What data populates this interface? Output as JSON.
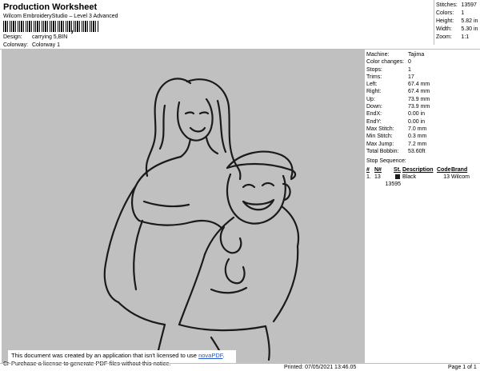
{
  "header": {
    "title": "Production Worksheet",
    "subtitle": "Wilcom EmbroideryStudio – Level 3 Advanced",
    "barcode_comma": ",",
    "design_label": "Design:",
    "design_value": "carrying 5,BIN",
    "colorway_label": "Colorway:",
    "colorway_value": "Colorway 1"
  },
  "summary": [
    {
      "label": "Stitches:",
      "value": "13597"
    },
    {
      "label": "Colors:",
      "value": "1"
    },
    {
      "label": "Height:",
      "value": "5.82 in"
    },
    {
      "label": "Width:",
      "value": "5.30 in"
    },
    {
      "label": "Zoom:",
      "value": "1:1"
    }
  ],
  "machine": [
    {
      "label": "Machine:",
      "value": "Tajima"
    },
    {
      "label": "Color changes:",
      "value": "0"
    },
    {
      "label": "Stops:",
      "value": "1"
    },
    {
      "label": "Trims:",
      "value": "17"
    },
    {
      "label": "Left:",
      "value": "67.4 mm"
    },
    {
      "label": "Right:",
      "value": "67.4 mm"
    },
    {
      "label": "Up:",
      "value": "73.9 mm"
    },
    {
      "label": "Down:",
      "value": "73.9 mm"
    },
    {
      "label": "EndX:",
      "value": "0.00 in"
    },
    {
      "label": "EndY:",
      "value": "0.00 in"
    },
    {
      "label": "Max Stitch:",
      "value": "7.0 mm"
    },
    {
      "label": "Min Stitch:",
      "value": "0.3 mm"
    },
    {
      "label": "Max Jump:",
      "value": "7.2 mm"
    },
    {
      "label": "Total Bobbin:",
      "value": "53.60ft"
    }
  ],
  "stop_sequence": {
    "title": "Stop Sequence:",
    "headers": [
      "#",
      "N#",
      "St.",
      "Description",
      "Code",
      "Brand"
    ],
    "rows": [
      {
        "num": "1.",
        "needle": "13",
        "stitches": "13595",
        "description": "Black",
        "code": "13",
        "brand": "Wilcom",
        "color": "#1a1a1a"
      }
    ]
  },
  "notice": {
    "line1": "This document was created by an application that isn't licensed to use",
    "link": "novaPDF",
    "line1_end": ".",
    "line2": "Purchase a license to generate PDF files without this notice.",
    "cr": "Cr"
  },
  "footer": {
    "printed": "Printed: 07/05/2021 13:46.05",
    "page": "Page 1 of 1"
  },
  "colors": {
    "design_background": "#c0c0c0",
    "thread": "#1a1a1a",
    "link": "#2255cc"
  }
}
